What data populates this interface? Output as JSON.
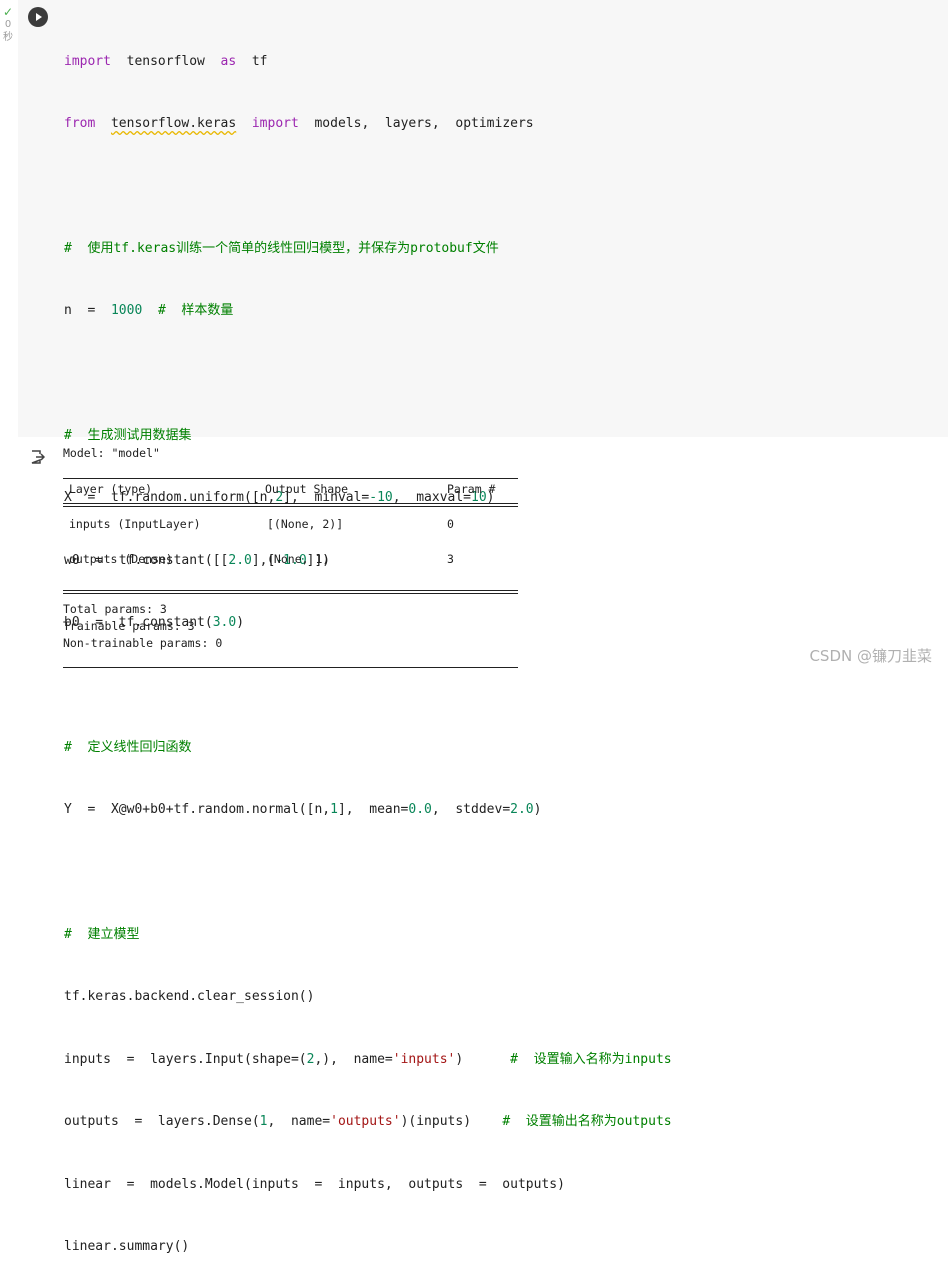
{
  "exec_status": {
    "check_glyph": "✓",
    "duration": "0",
    "unit": "秒"
  },
  "code_lines": [
    "import  tensorflow  as  tf",
    "from  tensorflow.keras  import  models,  layers,  optimizers",
    "",
    "#  使用tf.keras训练一个简单的线性回归模型，并保存为protobuf文件",
    "n  =  1000  #  样本数量",
    "",
    "#  生成测试用数据集",
    "X  =  tf.random.uniform([n,2],  minval=-10,  maxval=10)",
    "w0  =  tf.constant([[2.0],[-1.0]])",
    "b0  =  tf.constant(3.0)",
    "",
    "#  定义线性回归函数",
    "Y  =  X@w0+b0+tf.random.normal([n,1],  mean=0.0,  stddev=2.0)",
    "",
    "#  建立模型",
    "tf.keras.backend.clear_session()",
    "inputs  =  layers.Input(shape=(2,),  name='inputs')      #  设置输入名称为inputs",
    "outputs  =  layers.Dense(1,  name='outputs')(inputs)    #  设置输出名称为outputs",
    "linear  =  models.Model(inputs  =  inputs,  outputs  =  outputs)",
    "linear.summary()"
  ],
  "output": {
    "model_title": "Model: \"model\"",
    "headers": [
      "Layer (type)",
      "Output Shape",
      "Param #"
    ],
    "rows": [
      [
        "inputs (InputLayer)",
        "[(None, 2)]",
        "0"
      ],
      [
        "outputs (Dense)",
        "(None, 1)",
        "3"
      ]
    ],
    "total_params": "Total params: 3",
    "trainable_params": "Trainable params: 3",
    "non_trainable_params": "Non-trainable params: 0"
  },
  "watermark": "CSDN @镰刀韭菜",
  "colors": {
    "keyword": "#9c27b0",
    "number": "#098658",
    "string": "#a31515",
    "comment": "#008000",
    "cell_bg": "#f7f7f7"
  },
  "icons": {
    "run": "play-icon",
    "output": "output-redirect-icon",
    "status": "check-icon"
  }
}
